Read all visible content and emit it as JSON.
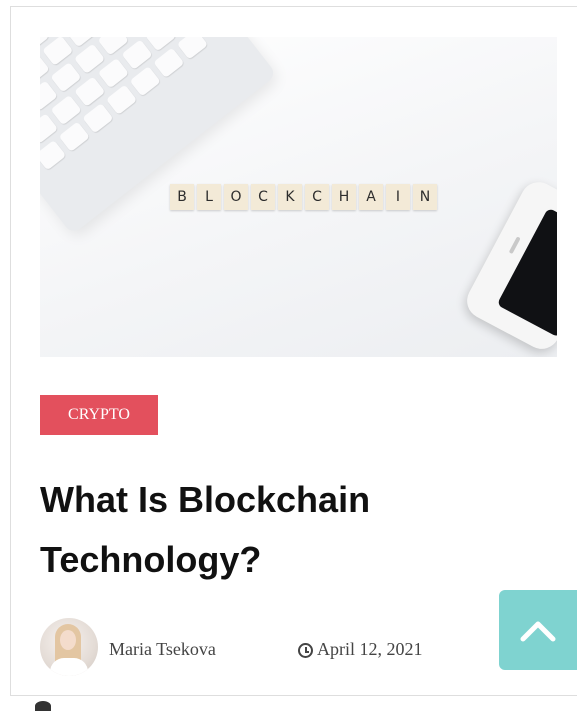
{
  "hero": {
    "alt": "Scrabble tiles spelling BLOCKCHAIN next to a keyboard and a phone",
    "tiles": [
      "B",
      "L",
      "O",
      "C",
      "K",
      "C",
      "H",
      "A",
      "I",
      "N"
    ]
  },
  "post": {
    "category": "CRYPTO",
    "title": "What Is Blockchain Technology?",
    "author": "Maria Tsekova",
    "date": "April 12, 2021"
  },
  "icons": {
    "clock": "clock-icon",
    "back_to_top": "chevron-up-icon"
  },
  "colors": {
    "badge": "#e3505d",
    "back_to_top": "#7fd3d0",
    "title": "#111111",
    "meta": "#444444"
  }
}
